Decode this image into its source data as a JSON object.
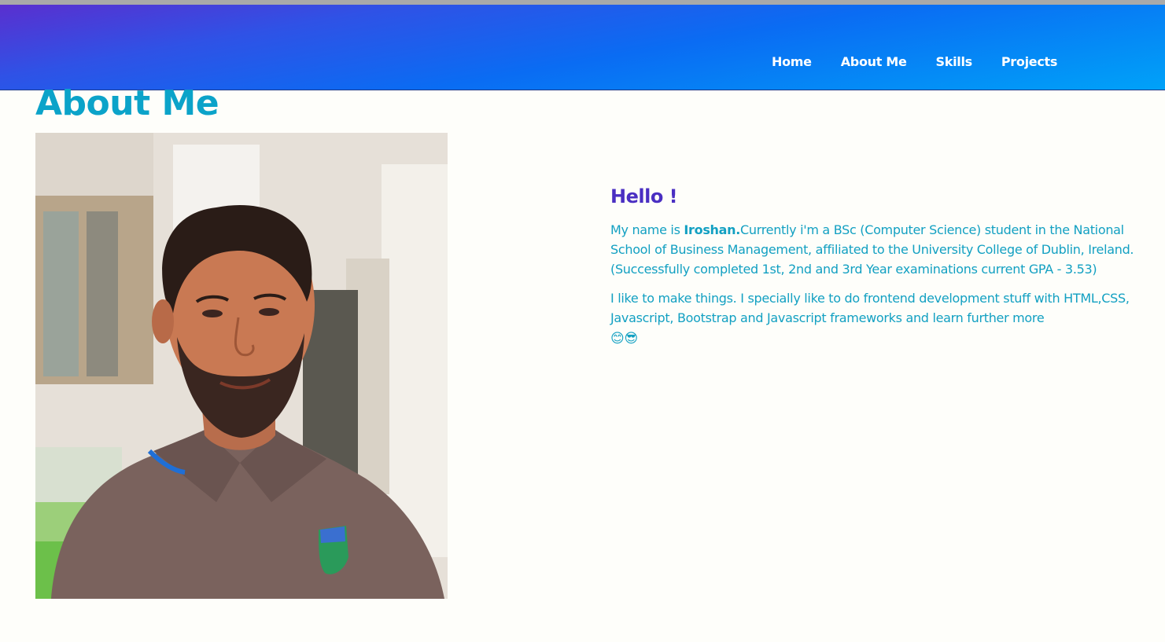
{
  "nav": {
    "items": [
      {
        "label": "Home"
      },
      {
        "label": "About Me"
      },
      {
        "label": "Skills"
      },
      {
        "label": "Projects"
      }
    ]
  },
  "about": {
    "title": "About Me",
    "photo_alt": "Portrait of Iroshan",
    "greeting": "Hello !",
    "intro_prefix": "My name is ",
    "name": "Iroshan.",
    "intro_rest": "Currently i'm a BSc (Computer Science) student in the National School of Business Management, affiliated to the University College of Dublin, Ireland. (Successfully completed 1st, 2nd and 3rd Year examinations current GPA - 3.53)",
    "hobbies": "I like to make things. I specially like to do frontend development stuff with HTML,CSS, Javascript, Bootstrap and Javascript frameworks and learn further more",
    "emojis": [
      {
        "icon": "smiling-face-icon",
        "glyph": "😊"
      },
      {
        "icon": "sunglasses-face-icon",
        "glyph": "😎"
      }
    ]
  },
  "colors": {
    "title": "#0ba3c9",
    "greeting": "#4a2fc2",
    "body_text": "#12a0c2",
    "nav_gradient_start": "#5a2fcf",
    "nav_gradient_end": "#00a2f8",
    "page_background": "#fefefa"
  }
}
